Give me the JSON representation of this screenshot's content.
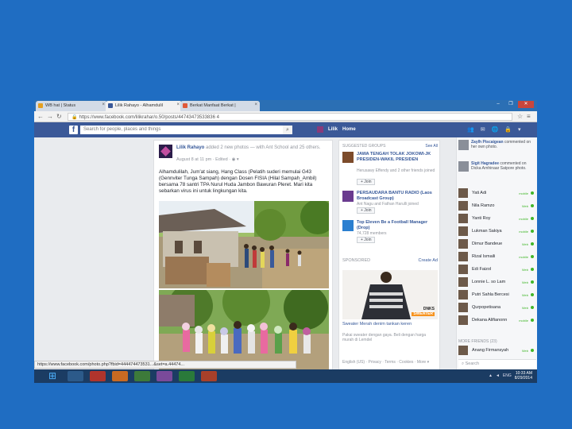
{
  "browser": {
    "tabs": [
      {
        "label": "WB hat | Status",
        "icon_color": "#e5a021",
        "active": false
      },
      {
        "label": "Lilik Rahayo - Alhamdulil",
        "icon_color": "#3b5998",
        "active": true
      },
      {
        "label": "Berkat Manfaat Berkat |",
        "icon_color": "#e05a3a",
        "active": false
      }
    ],
    "url": "https://www.facebook.com/lilikrahar/o.50/posts/44743473533836 4",
    "window_controls": {
      "minimize": "–",
      "maximize": "❐",
      "close": "✕"
    }
  },
  "fb": {
    "logo": "f",
    "search_placeholder": "Search for people, places and things",
    "user_name": "Lilik",
    "home": "Home",
    "post": {
      "author": "Lilik Rahayo",
      "header_rest": " added 2 new photos — with Ant School and 25 others.",
      "meta": "August 8 at 11 pm · Edited · ◉ ▾",
      "text": "Alhamdulilah, Jum'at siang, Hang Class (Pelatih suderi memulai G43 (Gennviter Tunga Sampah) dengan Dosen FISIA (Hilal Sampah_Ambil) bersama 78 santri TPA Nurul Huda Jambon Bawuran Pleret. Mari kita sebarkan virus ini untuk lingkungan kita."
    },
    "status_url": "https://www.facebook.com/photo.php?fbid=444474473531...&set=a.44474..."
  },
  "right_col": {
    "suggested_header": "SUGGESTED GROUPS",
    "see_all": "See All",
    "groups": [
      {
        "name": "JAWA TENGAH TOLAK JOKOWI-JK PRESIDEN-WAKIL PRESIDEN",
        "sub": "Herusawy Effendy and 2 other friends joined",
        "join": "+ Join",
        "color": "#7c4b2b"
      },
      {
        "name": "PERSAUDARA BANTU RADIO (Laos Broadcast Group)",
        "sub": "Ant Nagu and Fathan Harulli joined",
        "join": "+ Join",
        "color": "#6a3b8f"
      },
      {
        "name": "Top Eleven Be a Football Manager (Drop)",
        "sub": "74,728 members",
        "join": "+ Join",
        "color": "#2b7fd0"
      }
    ],
    "sponsored_label": "SPONSORED",
    "create_ad": "Create Ad",
    "ad": {
      "brand_line1": "DNKS",
      "brand_line2": "SWEATER",
      "title": "Sweater Merah denim tankan keren",
      "desc": "Pakai sweater dengan gaya. Beli dengan harga murah di Lemdel"
    },
    "footer": "English (US) · Privacy · Terms · Cookies · More ▾"
  },
  "chat": {
    "ticker": [
      {
        "name": "Zaylh Piscaigean",
        "text": " commented on her own photo."
      },
      {
        "name": "Sigit Hagradee",
        "text": " commented on Dicka Arnhinaar Satpore photo."
      }
    ],
    "contacts": [
      {
        "name": "Yati Adi",
        "status": "mobile"
      },
      {
        "name": "Nila Ramzo",
        "status": "Web"
      },
      {
        "name": "Yanti Roy",
        "status": "mobile"
      },
      {
        "name": "Lukman Sakiya",
        "status": "mobile"
      },
      {
        "name": "Dimur Bandeue",
        "status": "Web"
      },
      {
        "name": "Rizal Ismaili",
        "status": "mobile"
      },
      {
        "name": "Edi Faizol",
        "status": "Web"
      },
      {
        "name": "Lonnie L. so Lam",
        "status": "Web"
      },
      {
        "name": "Putri Sahla Bercesi",
        "status": "Web"
      },
      {
        "name": "Qurpopetisana",
        "status": "Web"
      },
      {
        "name": "Dekana Alifianonn",
        "status": "mobile"
      }
    ],
    "more_friends": "MORE FRIENDS (23)",
    "last_contact": {
      "name": "Anang Firmansyah",
      "status": "Web"
    },
    "search": "Search"
  },
  "taskbar": {
    "lang": "ENG",
    "time": "10:33 AM",
    "date": "8/29/2014"
  }
}
